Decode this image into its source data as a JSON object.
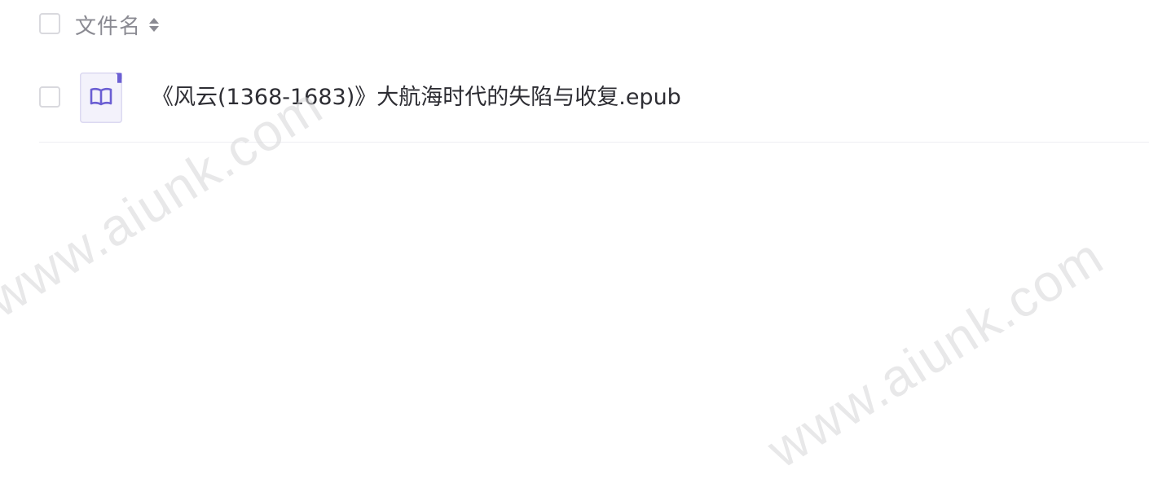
{
  "table": {
    "header": {
      "column_label": "文件名",
      "sort_icon": "sort-icon"
    },
    "rows": [
      {
        "icon": "epub-book-icon",
        "name": "《风云(1368-1683)》大航海时代的失陷与收复.epub"
      }
    ]
  },
  "watermarks": [
    "www.aiunk.com",
    "www.aiunk.com"
  ],
  "colors": {
    "icon_accent": "#6b5fd3",
    "icon_bg": "#f3f2fb",
    "text_primary": "#2d2d33",
    "text_secondary": "#8a8a92"
  }
}
